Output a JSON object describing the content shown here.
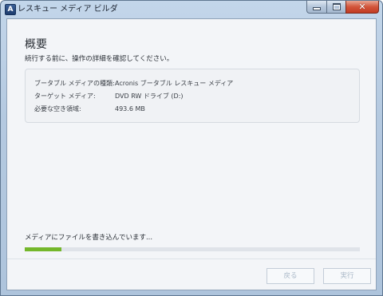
{
  "window": {
    "title": "レスキュー メディア ビルダ",
    "app_icon_letter": "A"
  },
  "page": {
    "title": "概要",
    "subtitle": "続行する前に、操作の詳細を確認してください。"
  },
  "summary": {
    "rows": [
      {
        "label": "ブータブル メディアの種類:",
        "value": "Acronis ブータブル レスキュー メディア"
      },
      {
        "label": "ターゲット メディア:",
        "value": "DVD RW ドライブ (D:)"
      },
      {
        "label": "必要な空き領域:",
        "value": "493.6 MB"
      }
    ]
  },
  "status": {
    "text": "メディアにファイルを書き込んでいます...",
    "progress_percent": 11
  },
  "buttons": {
    "back_label": "戻る",
    "run_label": "実行"
  },
  "colors": {
    "progress_fill": "#74b72b",
    "progress_track": "#dfe3e9",
    "close_button": "#c23b22"
  },
  "icons": {
    "close": "close-icon",
    "minimize": "minimize-icon",
    "maximize": "maximize-icon",
    "app": "acronis-app-icon"
  }
}
